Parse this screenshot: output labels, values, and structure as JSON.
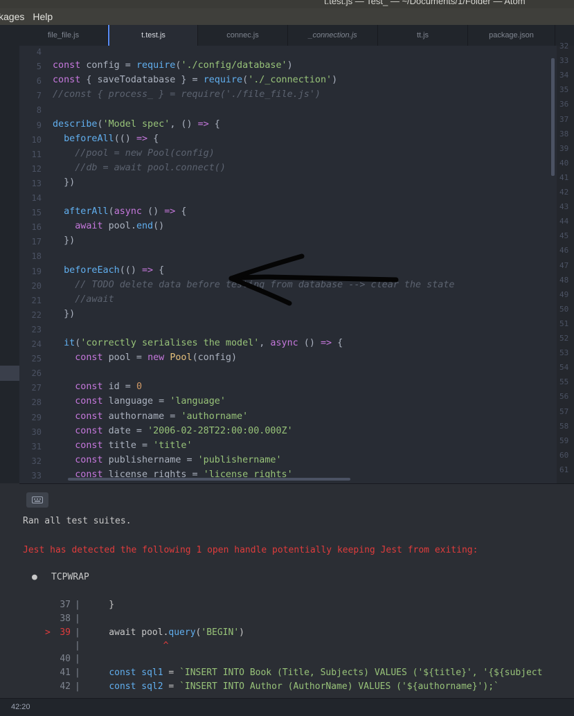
{
  "window": {
    "title": "t.test.js — Test_ — ~/Documents/1/Folder — Atom"
  },
  "menubar": {
    "items": [
      "kages",
      "Help"
    ]
  },
  "tabs": [
    {
      "label": "file_file.js",
      "active": false,
      "italic": false
    },
    {
      "label": "t.test.js",
      "active": true,
      "italic": false
    },
    {
      "label": "connec.js",
      "active": false,
      "italic": false
    },
    {
      "label": "_connection.js",
      "active": false,
      "italic": true
    },
    {
      "label": "tt.js",
      "active": false,
      "italic": false
    },
    {
      "label": "package.json",
      "active": false,
      "italic": false
    }
  ],
  "editor": {
    "lines": [
      {
        "n": "4",
        "html": ""
      },
      {
        "n": "5",
        "html": "<span class=\"kw\">const</span> config = <span class=\"fn\">require</span>(<span class=\"str\">'./config/database'</span>)"
      },
      {
        "n": "6",
        "html": "<span class=\"kw\">const</span> { saveTodatabase } = <span class=\"fn\">require</span>(<span class=\"str\">'./_connection'</span>)"
      },
      {
        "n": "7",
        "html": "<span class=\"cm\">//const { process_ } = require('./file_file.js')</span>"
      },
      {
        "n": "8",
        "html": ""
      },
      {
        "n": "9",
        "html": "<span class=\"fn\">describe</span>(<span class=\"str\">'Model spec'</span>, () <span class=\"op\">=&gt;</span> {"
      },
      {
        "n": "10",
        "html": "  <span class=\"fn\">beforeAll</span>(() <span class=\"op\">=&gt;</span> {"
      },
      {
        "n": "11",
        "html": "    <span class=\"cm\">//pool = new Pool(config)</span>"
      },
      {
        "n": "12",
        "html": "    <span class=\"cm\">//db = await pool.connect()</span>"
      },
      {
        "n": "13",
        "html": "  })"
      },
      {
        "n": "14",
        "html": ""
      },
      {
        "n": "15",
        "html": "  <span class=\"fn\">afterAll</span>(<span class=\"kw\">async</span> () <span class=\"op\">=&gt;</span> {"
      },
      {
        "n": "16",
        "html": "    <span class=\"kw\">await</span> pool.<span class=\"fn\">end</span>()"
      },
      {
        "n": "17",
        "html": "  })"
      },
      {
        "n": "18",
        "html": ""
      },
      {
        "n": "19",
        "html": "  <span class=\"fn\">beforeEach</span>(() <span class=\"op\">=&gt;</span> {"
      },
      {
        "n": "20",
        "html": "    <span class=\"cm\">// TODO delete data before testing from database --&gt; clear the state</span>"
      },
      {
        "n": "21",
        "html": "    <span class=\"cm\">//await</span>"
      },
      {
        "n": "22",
        "html": "  })"
      },
      {
        "n": "23",
        "html": ""
      },
      {
        "n": "24",
        "html": "  <span class=\"fn\">it</span>(<span class=\"str\">'correctly serialises the model'</span>, <span class=\"kw\">async</span> () <span class=\"op\">=&gt;</span> {"
      },
      {
        "n": "25",
        "html": "    <span class=\"kw\">const</span> pool = <span class=\"kw\">new</span> <span class=\"cls\">Pool</span>(config)"
      },
      {
        "n": "26",
        "html": ""
      },
      {
        "n": "27",
        "html": "    <span class=\"kw\">const</span> id = <span class=\"num\">0</span>"
      },
      {
        "n": "28",
        "html": "    <span class=\"kw\">const</span> language = <span class=\"str\">'language'</span>"
      },
      {
        "n": "29",
        "html": "    <span class=\"kw\">const</span> authorname = <span class=\"str\">'authorname'</span>"
      },
      {
        "n": "30",
        "html": "    <span class=\"kw\">const</span> date = <span class=\"str\">'2006-02-28T22:00:00.000Z'</span>"
      },
      {
        "n": "31",
        "html": "    <span class=\"kw\">const</span> title = <span class=\"str\">'title'</span>"
      },
      {
        "n": "32",
        "html": "    <span class=\"kw\">const</span> publishername = <span class=\"str\">'publishername'</span>"
      },
      {
        "n": "33",
        "html": "    <span class=\"kw\">const</span> license_rights = <span class=\"str\">'license_rights'</span>"
      }
    ]
  },
  "right_gutter": {
    "numbers": [
      "32",
      "33",
      "34",
      "35",
      "36",
      "37",
      "38",
      "39",
      "40",
      "41",
      "42",
      "43",
      "44",
      "45",
      "46",
      "47",
      "48",
      "49",
      "50",
      "51",
      "52",
      "53",
      "54",
      "55",
      "56",
      "57",
      "58",
      "59",
      "60",
      "61"
    ]
  },
  "terminal": {
    "ran_text": "Ran all test suites.",
    "error_text": "Jest has detected the following 1 open handle potentially keeping Jest from exiting:",
    "bullet": "●",
    "handle_name": "TCPWRAP",
    "code_frame": [
      {
        "marker": "",
        "num": "37",
        "html": "    }"
      },
      {
        "marker": "",
        "num": "38",
        "html": ""
      },
      {
        "marker": ">",
        "num": "39",
        "html": "    await pool.<span class=\"fn\">query</span>(<span class=\"str\">'BEGIN'</span>)"
      },
      {
        "marker": "",
        "num": "",
        "html": "              <span style=\"color:#e03c3c\">^</span>"
      },
      {
        "marker": "",
        "num": "40",
        "html": ""
      },
      {
        "marker": "",
        "num": "41",
        "html": "    <span class=\"fn\">const</span> <span class=\"fn\">sql1</span> = <span class=\"str\">`INSERT INTO Book (Title, Subjects) VALUES ('${title}', '{${subject</span>"
      },
      {
        "marker": "",
        "num": "42",
        "html": "    <span class=\"fn\">const</span> <span class=\"fn\">sql2</span> = <span class=\"str\">`INSERT INTO Author (AuthorName) VALUES ('${authorname}');`</span>"
      }
    ]
  },
  "statusbar": {
    "cursor": "42:20"
  },
  "colors": {
    "accent": "#568af2",
    "error": "#e03c3c",
    "background": "#282c34"
  }
}
